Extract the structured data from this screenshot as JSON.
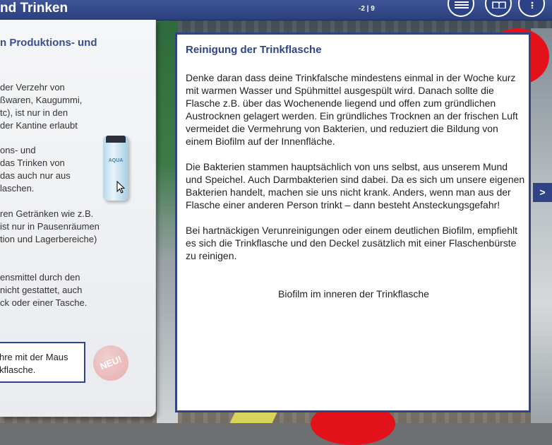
{
  "topbar": {
    "title": "nd Trinken",
    "page_indicator": "-2 | 9",
    "buttons": [
      "list-icon",
      "book-icon",
      "info-icon"
    ]
  },
  "left_panel": {
    "heading": "n Produktions- und",
    "lines_block1": [
      "der Verzehr von",
      "ßwaren, Kaugummi,",
      "tc), ist nur in den",
      " der Kantine erlaubt"
    ],
    "lines_block2": [
      "ons- und",
      "das Trinken von",
      "das auch nur aus",
      "laschen."
    ],
    "lines_block3": [
      "ren Getränken wie z.B.",
      " ist nur in Pausenräumen",
      "tion und Lagerbereiche)"
    ],
    "lines_block4": [
      "ensmittel durch den",
      " nicht gestattet, auch",
      "ck oder einer Tasche."
    ],
    "bottle_label": "AQUA",
    "hint_lines": [
      "hre mit der Maus",
      "kflasche."
    ],
    "badge": "NEU!"
  },
  "next_arrow": ">",
  "modal": {
    "title": "Reinigung der Trinkflasche",
    "paragraphs": [
      "Denke daran dass deine Trinkfalsche mindestens einmal in der Woche kurz mit warmen Wasser und Spühmittel ausgespült wird. Danach sollte die Flasche z.B. über das Wochenende liegend und offen zum gründlichen Austrocknen gelagert werden. Ein gründliches Trocknen an der frischen Luft vermeidet die Vermehrung von Bakterien, und reduziert die Bildung von einem Biofilm auf der Innenfläche.",
      "Die Bakterien stammen hauptsächlich von uns selbst, aus unserem Mund und Speichel. Auch Darmbakterien sind dabei. Da es sich um unsere eigenen Bakterien handelt, machen sie uns nicht krank. Anders, wenn man aus der Flasche einer anderen Person trinkt – dann besteht Ansteckungsgefahr!",
      "Bei hartnäckigen Verunreinigungen oder einem deutlichen Biofilm, empfiehlt es sich die Trinkflasche und den Deckel zusätzlich mit einer Flaschenbürste zu reinigen."
    ],
    "caption": "Biofilm im inneren der Trinkflasche"
  },
  "colors": {
    "brand_blue": "#2f4486",
    "heading_blue": "#3a4f92",
    "accent_red": "#e3121a"
  }
}
